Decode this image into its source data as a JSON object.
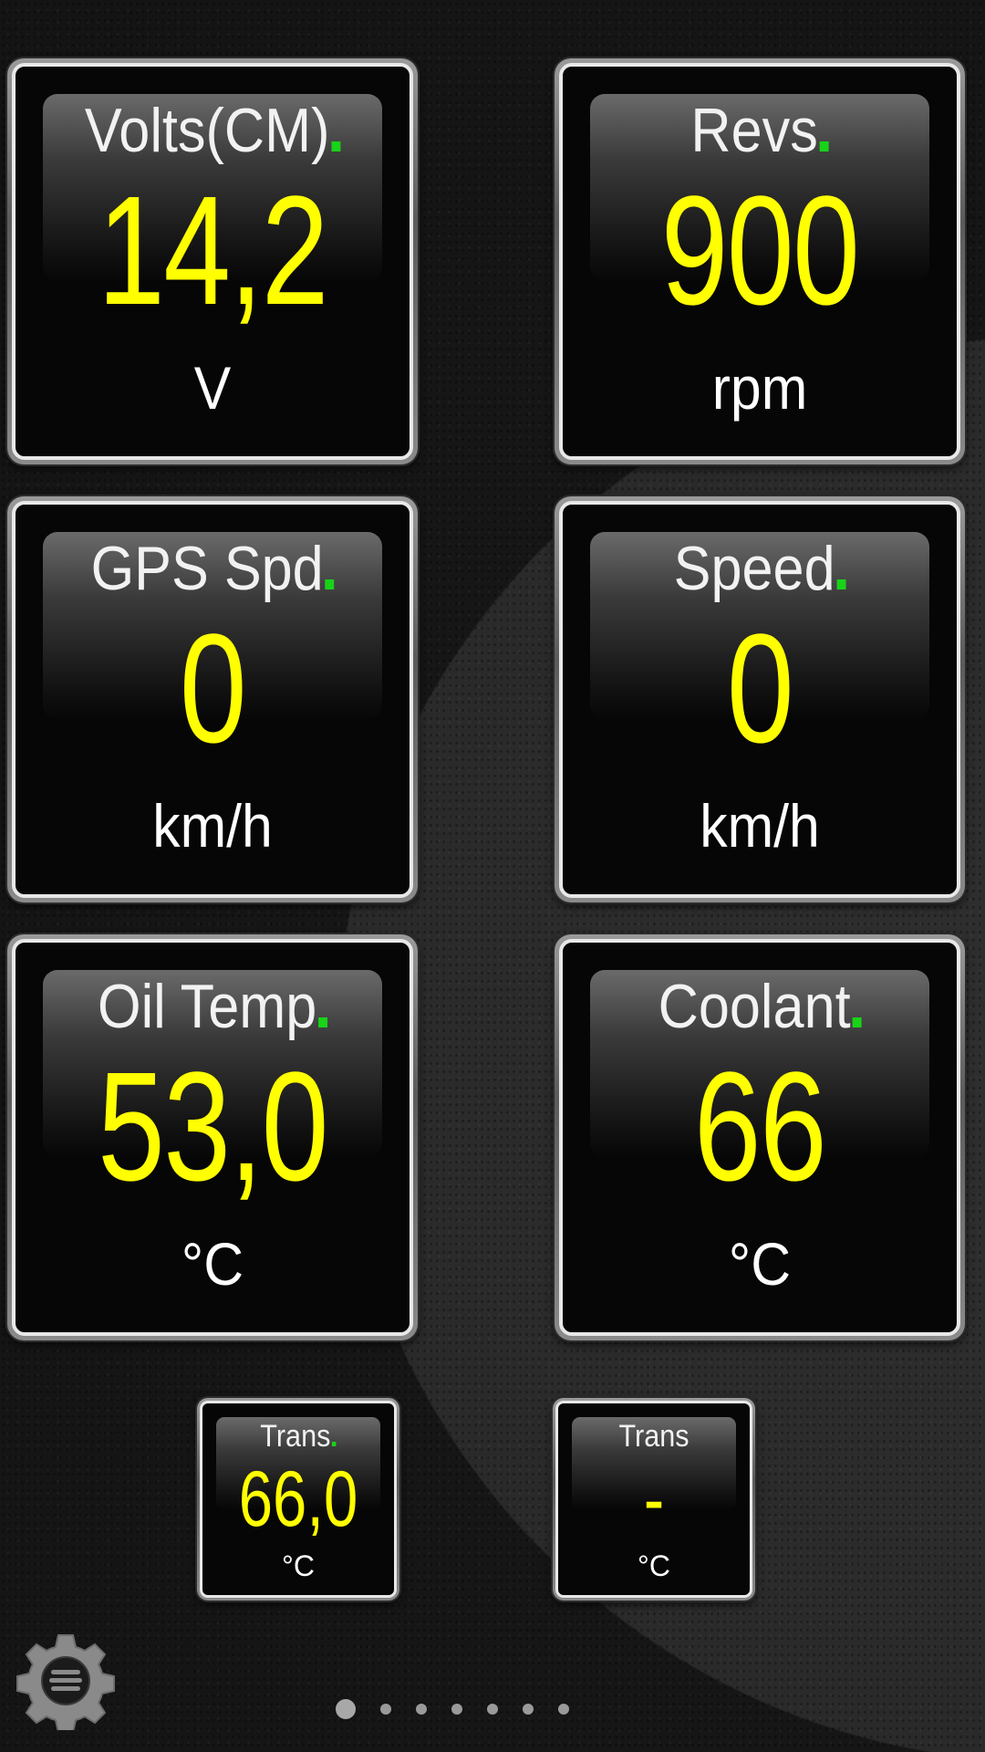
{
  "gauges": [
    {
      "title": "Volts(CM)",
      "value": "14,2",
      "unit": "V",
      "status_dot": true
    },
    {
      "title": "Revs",
      "value": "900",
      "unit": "rpm",
      "status_dot": true
    },
    {
      "title": "GPS Spd",
      "value": "0",
      "unit": "km/h",
      "status_dot": true
    },
    {
      "title": "Speed",
      "value": "0",
      "unit": "km/h",
      "status_dot": true
    },
    {
      "title": "Oil Temp",
      "value": "53,0",
      "unit": "°C",
      "status_dot": true
    },
    {
      "title": "Coolant",
      "value": "66",
      "unit": "°C",
      "status_dot": true
    }
  ],
  "small_gauges": [
    {
      "title": "Trans",
      "value": "66,0",
      "unit": "°C",
      "status_dot": true
    },
    {
      "title": "Trans",
      "value": "-",
      "unit": "°C",
      "status_dot": false
    }
  ],
  "colors": {
    "value": "#ffff00",
    "status_dot": "#18d318",
    "label": "#f2f2f2"
  },
  "settings_icon": "gear-menu-icon",
  "pager": {
    "pages": 7,
    "active": 1
  }
}
